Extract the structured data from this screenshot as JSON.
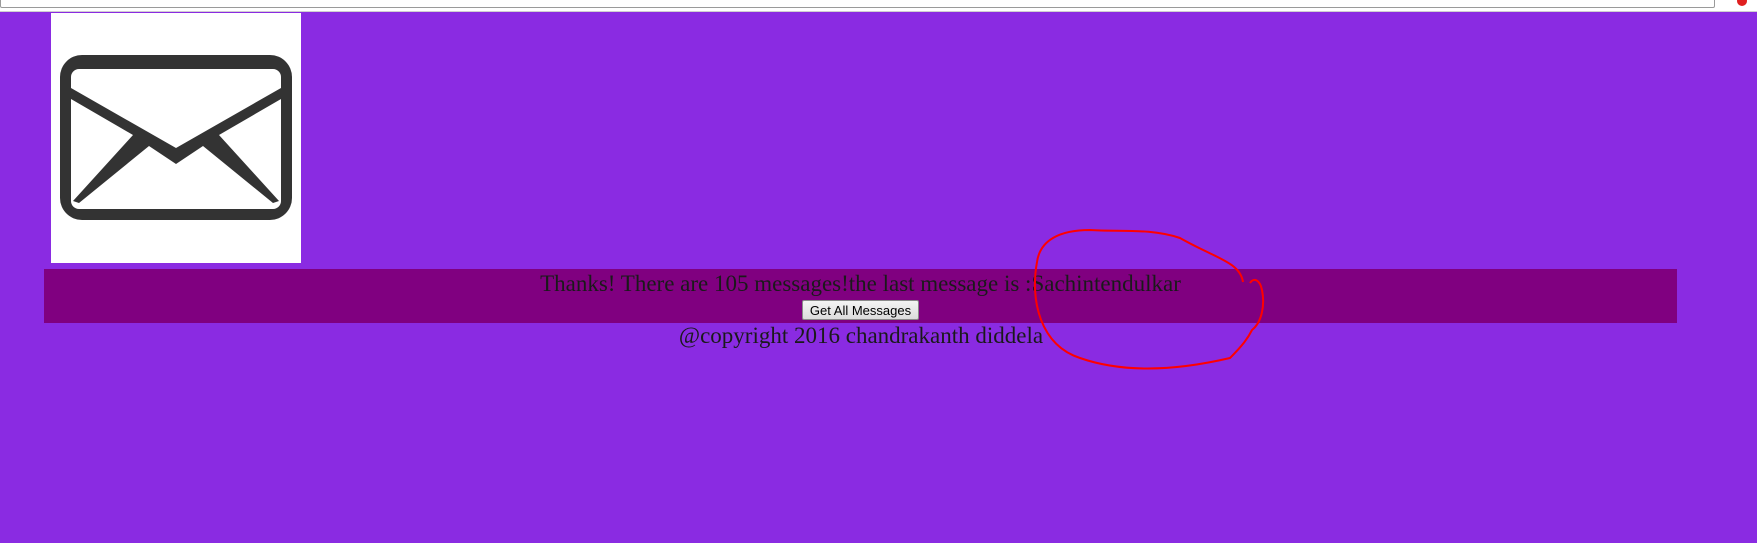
{
  "logo": {
    "icon": "envelope-icon"
  },
  "banner": {
    "message": "Thanks! There are 105 messages!the last message is :Sachintendulkar",
    "button_label": "Get All Messages"
  },
  "footer": {
    "text": "@copyright 2016 chandrakanth diddela"
  },
  "colors": {
    "page_background": "#8a2be2",
    "banner_background": "#800080",
    "annotation_stroke": "#ff0000"
  },
  "annotation": {
    "shape": "freehand-circle"
  }
}
